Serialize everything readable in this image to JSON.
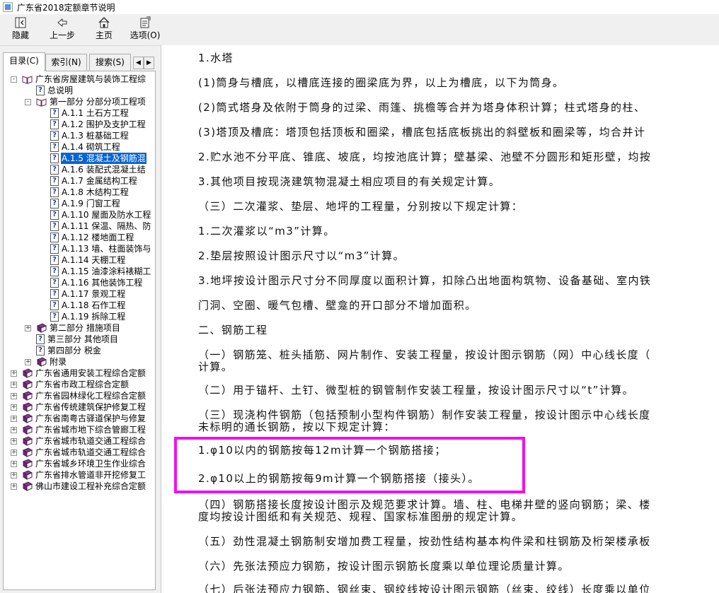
{
  "window": {
    "title": "广东省2018定额章节说明"
  },
  "toolbar": {
    "buttons": [
      {
        "label": "隐藏",
        "icon": "hide-pane-icon"
      },
      {
        "label": "上一步",
        "icon": "back-arrow-icon"
      },
      {
        "label": "主页",
        "icon": "home-icon"
      },
      {
        "label": "选项(O)",
        "icon": "options-icon"
      }
    ]
  },
  "tabs": [
    {
      "label": "目录(C)",
      "active": true
    },
    {
      "label": "索引(N)",
      "active": false
    },
    {
      "label": "搜索(S)",
      "active": false
    }
  ],
  "tree": [
    {
      "label": "广东省房屋建筑与装饰工程综",
      "type": "book-open",
      "expander": "-",
      "level": 0
    },
    {
      "label": "总说明",
      "type": "page",
      "level": 1
    },
    {
      "label": "第一部分 分部分项工程项",
      "type": "book-open",
      "expander": "-",
      "level": 1
    },
    {
      "label": "A.1.1 土石方工程",
      "type": "page",
      "level": 2
    },
    {
      "label": "A.1.2 围护及支护工程",
      "type": "page",
      "level": 2
    },
    {
      "label": "A.1.3 桩基础工程",
      "type": "page",
      "level": 2
    },
    {
      "label": "A.1.4 砌筑工程",
      "type": "page",
      "level": 2
    },
    {
      "label": "A.1.5 混凝土及钢筋混",
      "type": "page",
      "level": 2,
      "selected": true
    },
    {
      "label": "A.1.6 装配式混凝土结",
      "type": "page",
      "level": 2
    },
    {
      "label": "A.1.7 金属结构工程",
      "type": "page",
      "level": 2
    },
    {
      "label": "A.1.8 木结构工程",
      "type": "page",
      "level": 2
    },
    {
      "label": "A.1.9 门窗工程",
      "type": "page",
      "level": 2
    },
    {
      "label": "A.1.10 屋面及防水工程",
      "type": "page",
      "level": 2
    },
    {
      "label": "A.1.11 保温、隔热、防",
      "type": "page",
      "level": 2
    },
    {
      "label": "A.1.12 楼地面工程",
      "type": "page",
      "level": 2
    },
    {
      "label": "A.1.13 墙、柱面装饰与",
      "type": "page",
      "level": 2
    },
    {
      "label": "A.1.14 天棚工程",
      "type": "page",
      "level": 2
    },
    {
      "label": "A.1.15 油漆涂料裱糊工",
      "type": "page",
      "level": 2
    },
    {
      "label": "A.1.16 其他装饰工程",
      "type": "page",
      "level": 2
    },
    {
      "label": "A.1.17 景观工程",
      "type": "page",
      "level": 2
    },
    {
      "label": "A.1.18 石作工程",
      "type": "page",
      "level": 2
    },
    {
      "label": "A.1.19 拆除工程",
      "type": "page",
      "level": 2
    },
    {
      "label": "第二部分 措施项目",
      "type": "book",
      "expander": "+",
      "level": 1
    },
    {
      "label": "第三部分 其他项目",
      "type": "page",
      "level": 1
    },
    {
      "label": "第四部分 税金",
      "type": "page",
      "level": 1
    },
    {
      "label": "附录",
      "type": "book",
      "expander": "+",
      "level": 1
    },
    {
      "label": "广东省通用安装工程综合定额",
      "type": "book",
      "expander": "+",
      "level": 0
    },
    {
      "label": "广东省市政工程综合定额",
      "type": "book",
      "expander": "+",
      "level": 0
    },
    {
      "label": "广东省园林绿化工程综合定额",
      "type": "book",
      "expander": "+",
      "level": 0
    },
    {
      "label": "广东省传统建筑保护修复工程",
      "type": "book",
      "expander": "+",
      "level": 0
    },
    {
      "label": "广东省南粤古驿道保护与修复",
      "type": "book",
      "expander": "+",
      "level": 0
    },
    {
      "label": "广东省城市地下综合管廊工程",
      "type": "book",
      "expander": "+",
      "level": 0
    },
    {
      "label": "广东省城市轨道交通工程综合",
      "type": "book",
      "expander": "+",
      "level": 0
    },
    {
      "label": "广东省城市轨道交通工程综合",
      "type": "book",
      "expander": "+",
      "level": 0
    },
    {
      "label": "广东省城乡环境卫生作业综合",
      "type": "book",
      "expander": "+",
      "level": 0
    },
    {
      "label": "广东省排水管道非开挖修复工",
      "type": "book",
      "expander": "+",
      "level": 0
    },
    {
      "label": "佛山市建设工程补充综合定额",
      "type": "book",
      "expander": "+",
      "level": 0
    }
  ],
  "content": {
    "paragraphs": [
      "1.水塔",
      "(1)筒身与槽底，以槽底连接的圈梁底为界，以上为槽底，以下为筒身。",
      "(2)筒式塔身及依附于筒身的过梁、雨篷、挑檐等合并为塔身体积计算；柱式塔身的柱、",
      "(3)塔顶及槽底：塔顶包括顶板和圈梁，槽底包括底板挑出的斜壁板和圈梁等，均合并计",
      "2.贮水池不分平底、锥底、坡底，均按池底计算；壁基梁、池壁不分圆形和矩形壁，均按",
      "3.其他项目按现浇建筑物混凝土相应项目的有关规定计算。",
      "（三）二次灌浆、垫层、地坪的工程量，分别按以下规定计算：",
      "1.二次灌浆以“m3”计算。",
      "2.垫层按照设计图示尺寸以“m3”计算。",
      "3.地坪按设计图示尺寸分不同厚度以面积计算，扣除凸出地面构筑物、设备基础、室内铁",
      "门洞、空圈、暖气包槽、壁龛的开口部分不增加面积。",
      "二、钢筋工程",
      "（一）钢筋笼、桩头插筋、网片制作、安装工程量，按设计图示钢筋（网）中心线长度（",
      "计算。",
      "（二）用于锚杆、土钉、微型桩的钢管制作安装工程量，按设计图示尺寸以“t”计算。",
      "（三）现浇构件钢筋（包括预制小型构件钢筋）制作安装工程量，按设计图示中心线长度",
      "未标明的通长钢筋，按以下规定计算：",
      "1.φ10以内的钢筋按每12m计算一个钢筋搭接；",
      "2.φ10以上的钢筋按每9m计算一个钢筋搭接（接头）。",
      "（四）钢筋搭接长度按设计图示及规范要求计算。墙、柱、电梯井壁的竖向钢筋；梁、楼",
      "度均按设计图纸和有关规范、规程、国家标准图册的规定计算。",
      "（五）劲性混凝土钢筋制安增加费工程量，按劲性结构基本构件梁和柱钢筋及桁架楼承板",
      "（六）先张法预应力钢筋，按设计图示钢筋长度乘以单位理论质量计算。",
      "（七）后张法预应力钢筋、钢丝束、钢绞线按设计图示钢筋（丝束、绞线）长度乘以单位"
    ]
  },
  "colors": {
    "selection": "#0a64d0",
    "highlight_box": "#ee10ee"
  }
}
